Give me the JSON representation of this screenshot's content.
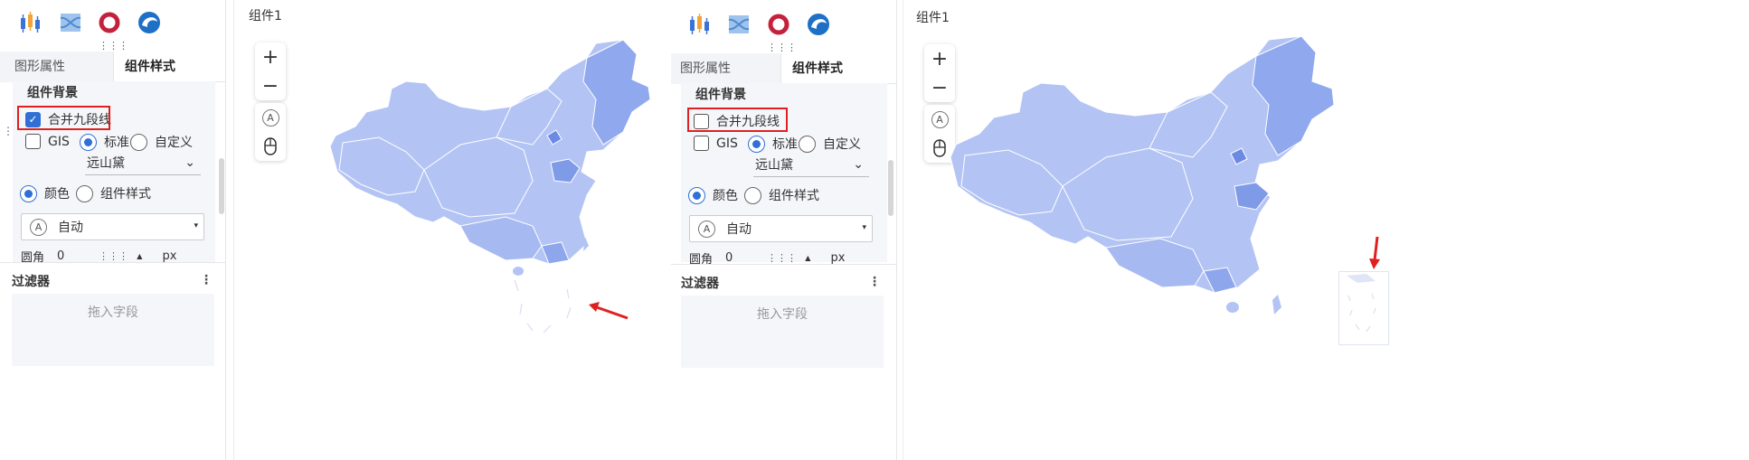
{
  "panels": [
    {
      "id": "left",
      "props": {
        "tabs": {
          "inactive": "图形属性",
          "active": "组件样式"
        },
        "section_title": "组件背景",
        "merge_line": {
          "label": "合并九段线",
          "checked": true
        },
        "gis_label": "GIS",
        "standard_label": "标准",
        "custom_label": "自定义",
        "theme_value": "远山黛",
        "color_label": "颜色",
        "style_label": "组件样式",
        "auto_value": "自动",
        "radius_label": "圆角",
        "radius_value": "0",
        "radius_unit": "px",
        "filter_title": "过滤器",
        "drop_hint": "拖入字段"
      },
      "canvas": {
        "component_title": "组件1"
      }
    },
    {
      "id": "right",
      "props": {
        "tabs": {
          "inactive": "图形属性",
          "active": "组件样式"
        },
        "section_title": "组件背景",
        "merge_line": {
          "label": "合并九段线",
          "checked": false
        },
        "gis_label": "GIS",
        "standard_label": "标准",
        "custom_label": "自定义",
        "theme_value": "远山黛",
        "color_label": "颜色",
        "style_label": "组件样式",
        "auto_value": "自动",
        "radius_label": "圆角",
        "radius_value": "0",
        "radius_unit": "px",
        "filter_title": "过滤器",
        "drop_hint": "拖入字段"
      },
      "canvas": {
        "component_title": "组件1"
      }
    }
  ],
  "icons": [
    "candlestick-chart-icon",
    "flow-map-icon",
    "ring-chart-icon",
    "swirl-chart-icon",
    "zoom-in-icon",
    "zoom-out-icon",
    "auto-icon",
    "mouse-icon"
  ],
  "colors": {
    "map_fill": "#b3c4f4",
    "map_dark": "#7f9be8",
    "accent": "#2f6fd6",
    "highlight": "#e02020"
  }
}
